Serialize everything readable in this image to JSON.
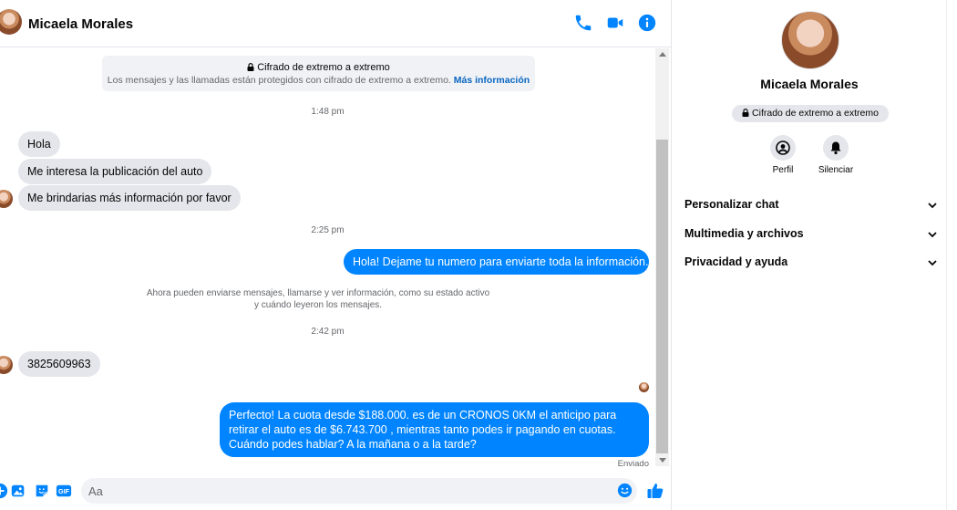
{
  "header": {
    "contact_name": "Micaela Morales",
    "icons": [
      "phone-icon",
      "video-camera-icon",
      "info-icon"
    ]
  },
  "encryption_notice": {
    "title": "Cifrado de extremo a extremo",
    "description": "Los mensajes y las llamadas están protegidos con cifrado de extremo a extremo.",
    "link": "Más información"
  },
  "messages": {
    "time_1": "1:48 pm",
    "in_1": "Hola",
    "in_2": "Me interesa la publicación del auto",
    "in_3": "Me brindarias más información por favor",
    "time_2": "2:25 pm",
    "out_1": "Hola! Dejame tu numero  para enviarte toda la información.",
    "system_note": "Ahora pueden enviarse mensajes, llamarse y ver información, como su estado activo y cuándo leyeron los mensajes.",
    "time_3": "2:42 pm",
    "in_4": "3825609963",
    "out_2": "Perfecto! La cuota desde $188.000. es de un CRONOS 0KM el anticipo para retirar el auto es de $6.743.700 , mientras tanto podes ir pagando en cuotas. Cuándo podes hablar? A la mañana o a la tarde?",
    "status": "Enviado"
  },
  "composer": {
    "placeholder": "Aa",
    "icons": [
      "plus-circle-icon",
      "image-gallery-icon",
      "sticker-icon",
      "gif-icon",
      "emoji-icon",
      "like-thumb-icon"
    ]
  },
  "panel": {
    "name": "Micaela Morales",
    "encryption_badge": "Cifrado de extremo a extremo",
    "actions": [
      {
        "label": "Perfil",
        "icon": "profile-icon"
      },
      {
        "label": "Silenciar",
        "icon": "bell-icon"
      }
    ],
    "sections": [
      {
        "label": "Personalizar chat"
      },
      {
        "label": "Multimedia y archivos"
      },
      {
        "label": "Privacidad y ayuda"
      }
    ]
  },
  "colors": {
    "accent": "#0084ff",
    "incoming_bubble": "#e4e6eb",
    "muted_text": "#65676b"
  }
}
